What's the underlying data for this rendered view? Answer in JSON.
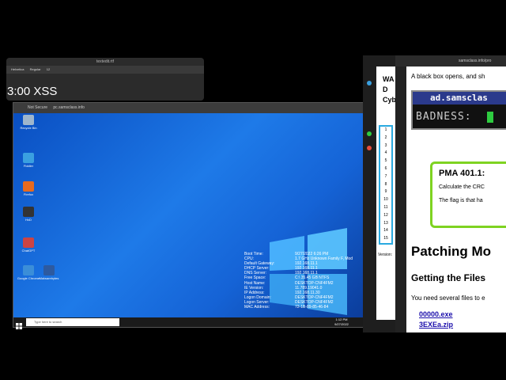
{
  "textedit": {
    "title": "textedit.rtf",
    "font": "Helvetica",
    "style": "Regular",
    "size": "12"
  },
  "overlay_time": "3:00 XSS",
  "rdp": {
    "tab_secure": "Not Secure",
    "tab_url": "pc.samsclass.info",
    "search_placeholder": "Type here to search",
    "clock_time": "1:12 PM",
    "clock_date": "9/27/2022",
    "desktop_icons": [
      {
        "label": "Recycle Bin",
        "color": "#9fb6cc"
      },
      {
        "label": "Fiddler",
        "color": "#3aa0e0"
      },
      {
        "label": "Firefox",
        "color": "#e66a1f"
      },
      {
        "label": "HxD",
        "color": "#333333"
      },
      {
        "label": "ChatGPT",
        "color": "#cc4444"
      },
      {
        "label": "Malwarebytes",
        "color": "#2d5aa0"
      },
      {
        "label": "Google Chrome",
        "color": "#3b8ed8"
      }
    ],
    "sysinfo": [
      {
        "k": "Boot Time:",
        "v": "9/27/2022 6:26 PM"
      },
      {
        "k": "CPU:",
        "v": "1.7 GHz Unknown Family F, Mod"
      },
      {
        "k": "Default Gateway:",
        "v": "192.168.11.1"
      },
      {
        "k": "DHCP Server:",
        "v": "192.168.11.1"
      },
      {
        "k": "DNS Server:",
        "v": "192.168.11.1"
      },
      {
        "k": "Free Space:",
        "v": "C:\\ 35.45 GB NTFS"
      },
      {
        "k": "Host Name:",
        "v": "DESKTOP-CNF4FM2"
      },
      {
        "k": "IE Version:",
        "v": "11.789.19041.0"
      },
      {
        "k": "IP Address:",
        "v": "192.168.11.30"
      },
      {
        "k": "Logon Domain:",
        "v": "DESKTOP-CNF4FM2"
      },
      {
        "k": "Logon Server:",
        "v": "DESKTOP-CNF4FM2"
      },
      {
        "k": "MAC Address:",
        "v": "72-1B-89-85-46-84"
      }
    ]
  },
  "scoreboard": {
    "title": "Scoreboard",
    "header_letters": [
      "WA",
      "D",
      "Cyb"
    ],
    "numbers": [
      "1",
      "2",
      "3",
      "4",
      "5",
      "6",
      "7",
      "8",
      "9",
      "10",
      "11",
      "12",
      "13",
      "14",
      "15"
    ],
    "version_label": "Version:"
  },
  "right_browser": {
    "url": "samsclass.info/pro",
    "intro_text": "A black box opens, and sh",
    "ad_title": "ad.samsclas",
    "badness_label": "BADNESS:",
    "pma_title": "PMA 401.1:",
    "pma_text1": "Calculate the CRC",
    "pma_text2": "The flag is that ha",
    "heading1": "Patching Mo",
    "heading2": "Getting the Files",
    "para": "You need several files to e",
    "link1": "00000.exe",
    "link2": "3EXEa.zip",
    "cursor_color": "#2ecc40"
  }
}
